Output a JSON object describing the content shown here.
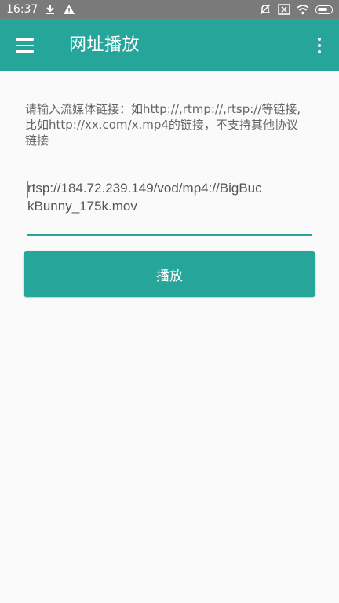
{
  "status_bar": {
    "time": "16:37",
    "icons_left": [
      "download-icon",
      "warning-icon"
    ],
    "icons_right": [
      "silent-icon",
      "sim-x-icon",
      "wifi-icon",
      "battery-icon"
    ]
  },
  "app_bar": {
    "title": "网址播放",
    "background": "#26a69a"
  },
  "hint": "请输入流媒体链接：如http://,rtmp://,rtsp://等链接,比如http://xx.com/x.mp4的链接，不支持其他协议链接",
  "url_input": {
    "value": "rtsp://184.72.239.149/vod/mp4://BigBuckBunny_175k.mov"
  },
  "play_button": {
    "label": "播放"
  },
  "colors": {
    "accent": "#26a69a",
    "status_bar": "#7a7a7a",
    "background": "#fafafa"
  }
}
